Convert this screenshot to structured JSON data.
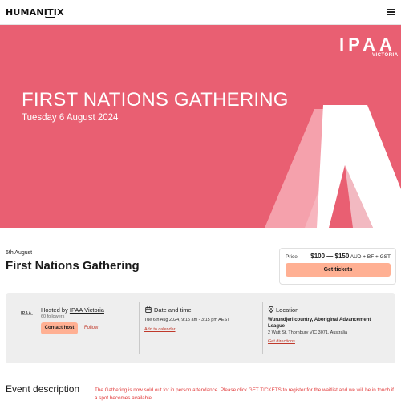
{
  "header": {
    "logo_text": "HUMANITIX",
    "menu_icon": "hamburger-menu-icon"
  },
  "banner": {
    "title": "FIRST NATIONS GATHERING",
    "date": "Tuesday 6 August 2024",
    "brand": "IPAA",
    "brand_sub": "VICTORIA",
    "background_color": "#e95f72"
  },
  "event": {
    "date_short": "6th August",
    "title": "First Nations Gathering"
  },
  "pricing": {
    "label": "Price",
    "range": "$100 — $150",
    "suffix": "AUD + BF + GST",
    "button_label": "Get tickets",
    "button_color": "#ffb093"
  },
  "host": {
    "logo_text": "IPAA",
    "hosted_prefix": "Hosted by",
    "name": "IPAA Victoria",
    "followers": "60 followers",
    "contact_label": "Contact host",
    "follow_label": "Follow"
  },
  "datetime": {
    "icon": "calendar-icon",
    "title": "Date and time",
    "value": "Tue 6th Aug 2024, 9:15 am - 3:15 pm AEST",
    "link": "Add to calendar"
  },
  "location": {
    "icon": "location-pin-icon",
    "title": "Location",
    "venue": "Wurundjeri country, Aboriginal Advancement League",
    "address": "2 Watt St, Thornbury VIC 3071, Australia",
    "link": "Get directions"
  },
  "description": {
    "heading": "Event description",
    "notice": "The Gathering is now sold out for in person attendance. Please click GET TICKETS to register for the waitlist and we will be in touch if a spot becomes available.",
    "notice_color": "#e23b3b"
  }
}
